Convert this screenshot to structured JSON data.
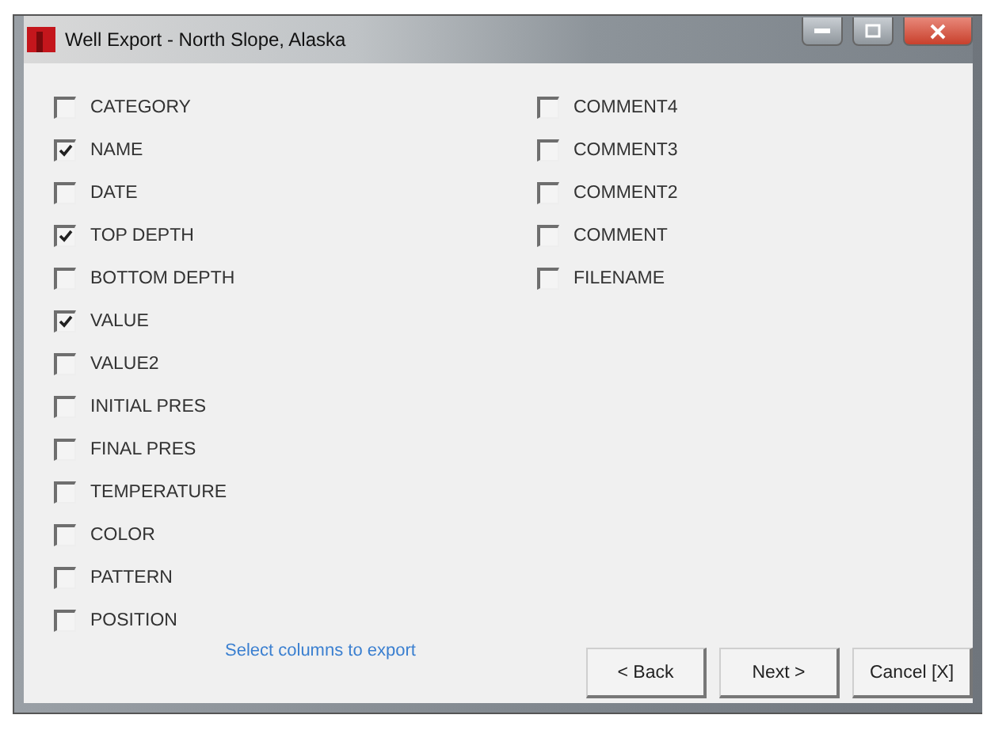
{
  "window": {
    "title": "Well Export - North Slope, Alaska"
  },
  "columns_left": [
    {
      "label": "CATEGORY",
      "checked": false
    },
    {
      "label": "NAME",
      "checked": true
    },
    {
      "label": "DATE",
      "checked": false
    },
    {
      "label": "TOP DEPTH",
      "checked": true
    },
    {
      "label": "BOTTOM DEPTH",
      "checked": false
    },
    {
      "label": "VALUE",
      "checked": true
    },
    {
      "label": "VALUE2",
      "checked": false
    },
    {
      "label": "INITIAL PRES",
      "checked": false
    },
    {
      "label": "FINAL PRES",
      "checked": false
    },
    {
      "label": "TEMPERATURE",
      "checked": false
    },
    {
      "label": "COLOR",
      "checked": false
    },
    {
      "label": "PATTERN",
      "checked": false
    },
    {
      "label": "POSITION",
      "checked": false
    }
  ],
  "columns_right": [
    {
      "label": "COMMENT4",
      "checked": false
    },
    {
      "label": "COMMENT3",
      "checked": false
    },
    {
      "label": "COMMENT2",
      "checked": false
    },
    {
      "label": "COMMENT",
      "checked": false
    },
    {
      "label": "FILENAME",
      "checked": false
    }
  ],
  "hint": "Select columns to export",
  "buttons": [
    "< Back",
    "Next >",
    "Cancel [X]"
  ]
}
